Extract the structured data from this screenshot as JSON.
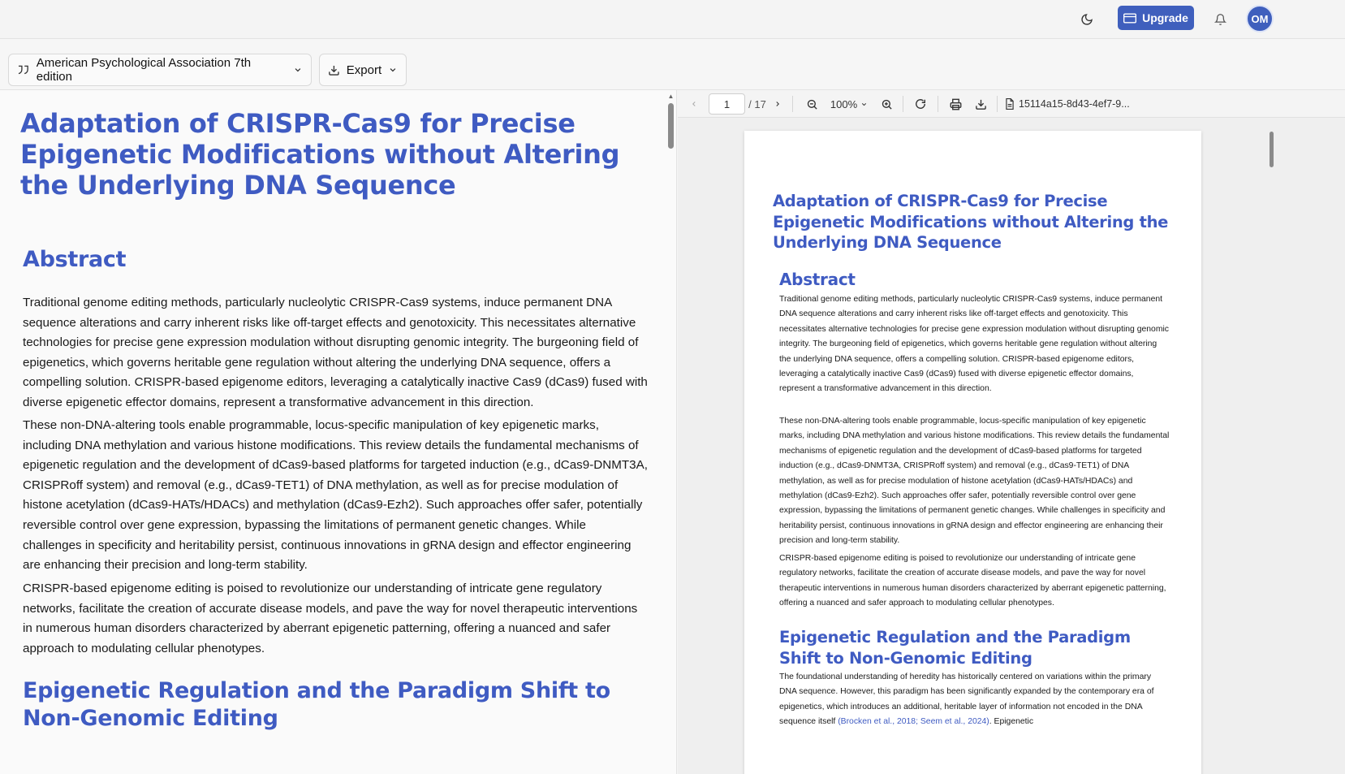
{
  "topbar": {
    "theme_icon": "moon-icon",
    "upgrade_label": "Upgrade",
    "notification_icon": "bell-icon",
    "avatar_initials": "OM",
    "accent": "#3f5fbd"
  },
  "toolbar": {
    "citation_style": "American Psychological Association 7th edition",
    "export_label": "Export"
  },
  "editor": {
    "title": "Adaptation of CRISPR-Cas9 for Precise Epigenetic Modifications without Altering the Underlying DNA Sequence",
    "abstract_heading": "Abstract",
    "abstract_p1": "Traditional genome editing methods, particularly nucleolytic CRISPR-Cas9 systems, induce permanent DNA sequence alterations and carry inherent risks like off-target effects and genotoxicity. This necessitates alternative technologies for precise gene expression modulation without disrupting genomic integrity. The burgeoning field of epigenetics, which governs heritable gene regulation without altering the underlying DNA sequence, offers a compelling solution. CRISPR-based epigenome editors, leveraging a catalytically inactive Cas9 (dCas9) fused with diverse epigenetic effector domains, represent a transformative advancement in this direction.",
    "abstract_p2": "These non-DNA-altering tools enable programmable, locus-specific manipulation of key epigenetic marks, including DNA methylation and various histone modifications. This review details the fundamental mechanisms of epigenetic regulation and the development of dCas9-based platforms for targeted induction (e.g., dCas9-DNMT3A, CRISPRoff system) and removal (e.g., dCas9-TET1) of DNA methylation, as well as for precise modulation of histone acetylation (dCas9-HATs/HDACs) and methylation (dCas9-Ezh2). Such approaches offer safer, potentially reversible control over gene expression, bypassing the limitations of permanent genetic changes. While challenges in specificity and heritability persist, continuous innovations in gRNA design and effector engineering are enhancing their precision and long-term stability.",
    "abstract_p3": "CRISPR-based epigenome editing is poised to revolutionize our understanding of intricate gene regulatory networks, facilitate the creation of accurate disease models, and pave the way for novel therapeutic interventions in numerous human disorders characterized by aberrant epigenetic patterning, offering a nuanced and safer approach to modulating cellular phenotypes.",
    "section2_heading": "Epigenetic Regulation and the Paradigm Shift to Non-Genomic Editing"
  },
  "viewer": {
    "current_page": "1",
    "total_pages": "/ 17",
    "zoom": "100%",
    "filename": "15114a15-8d43-4ef7-9...",
    "page": {
      "title": "Adaptation of CRISPR-Cas9 for Precise Epigenetic Modifications without Altering the Underlying DNA Sequence",
      "abstract_heading": "Abstract",
      "p1": "Traditional genome editing methods, particularly nucleolytic CRISPR-Cas9 systems, induce permanent DNA sequence alterations and carry inherent risks like off-target effects and genotoxicity. This necessitates alternative technologies for precise gene expression modulation without disrupting genomic integrity. The burgeoning field of epigenetics, which governs heritable gene regulation without altering the underlying DNA sequence, offers a compelling solution. CRISPR-based epigenome editors, leveraging a catalytically inactive Cas9 (dCas9) fused with diverse epigenetic effector domains, represent a transformative advancement in this direction.",
      "p2": "These non-DNA-altering tools enable programmable, locus-specific manipulation of key epigenetic marks, including DNA methylation and various histone modifications. This review details the fundamental mechanisms of epigenetic regulation and the development of dCas9-based platforms for targeted induction (e.g., dCas9-DNMT3A, CRISPRoff system) and removal (e.g., dCas9-TET1) of DNA methylation, as well as for precise modulation of histone acetylation (dCas9-HATs/HDACs) and methylation (dCas9-Ezh2). Such approaches offer safer, potentially reversible control over gene expression, bypassing the limitations of permanent genetic changes. While challenges in specificity and heritability persist, continuous innovations in gRNA design and effector engineering are enhancing their precision and long-term stability.",
      "p3": "CRISPR-based epigenome editing is poised to revolutionize our understanding of intricate gene regulatory networks, facilitate the creation of accurate disease models, and pave the way for novel therapeutic interventions in numerous human disorders characterized by aberrant epigenetic patterning, offering a nuanced and safer approach to modulating cellular phenotypes.",
      "section2_heading": "Epigenetic Regulation and the Paradigm Shift to Non-Genomic Editing",
      "section2_p1_start": "The foundational understanding of heredity has historically centered on variations within the primary DNA sequence. However, this paradigm has been significantly expanded by the contemporary era of epigenetics, which introduces an additional, heritable layer of information not encoded in the DNA sequence itself ",
      "section2_citation": "(Brocken et al., 2018; Seem et al., 2024)",
      "section2_p1_end": ". Epigenetic"
    }
  }
}
